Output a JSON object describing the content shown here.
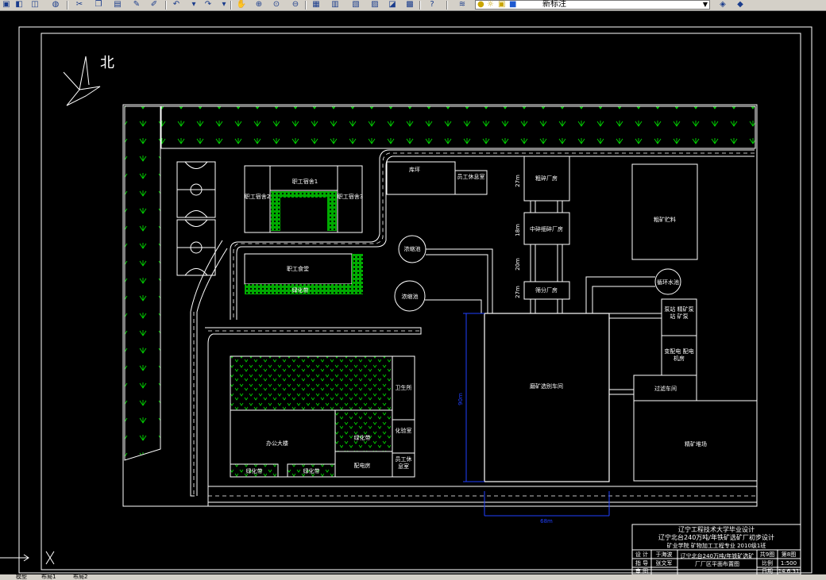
{
  "toolbar": {
    "layer_name": "新标注",
    "icons": [
      "open-icon",
      "save-icon",
      "print-icon",
      "cut-icon",
      "copy-icon",
      "paste-icon",
      "undo-icon",
      "redo-icon",
      "pan-icon",
      "zoom-icon",
      "zoom-window-icon",
      "zoom-previous-icon",
      "properties-icon",
      "design-center-icon",
      "tool-palette-icon",
      "calculator-icon",
      "help-icon",
      "layer-manager-icon",
      "layer-state-icon"
    ]
  },
  "drawing": {
    "north_label": "北",
    "buildings": {
      "dorm1": "职工宿舍1",
      "dorm2": "职工宿舍2",
      "dorm3": "职工宿舍3",
      "canteen": "职工食堂",
      "greenbelt": "绿化带",
      "warehouse": "库坪",
      "staff_rest_1": "员工休息室",
      "coarse_crusher": "粗碎厂房",
      "mid_fine_crusher": "中碎细碎厂房",
      "screening": "筛分厂房",
      "ore_bin": "粗矿贮料",
      "thickener_1": "浓缩池",
      "thickener_2": "浓缩池",
      "circulating_pool": "循环水池",
      "pump_house": "泵站 精矿泵站 矿泵",
      "substation": "变配电 配电机房",
      "main_plant": "磨矿选别车间",
      "filter_plant": "过滤车间",
      "concentrate_yard": "精矿堆场",
      "clinic": "卫生所",
      "lab": "化验室",
      "staff_rest_2": "员工休息室",
      "office": "办公大楼",
      "office_green": "绿化带",
      "green_1": "绿化带",
      "green_2": "绿化带",
      "power_room": "配电房"
    },
    "dims": {
      "d_coarse": "27m",
      "d_mid1": "18m",
      "d_mid2": "20m",
      "d_screen": "27m",
      "d_left": "90m",
      "d_bottom": "68m"
    },
    "title_block": {
      "school": "辽宁工程技术大学毕业设计",
      "project": "辽宁北台240万吨/年铁矿选矿厂初步设计",
      "major_line": "矿业学院  矿物加工工程专业  2010级1班",
      "r1": "设 计",
      "r1_name": "于海波",
      "r2": "指 导",
      "r2_name": "张文军",
      "r3": "审 图",
      "drawing_title": "辽宁北台240万吨/年铁矿选矿厂厂区平面布置图",
      "sheets": "共9图",
      "sheet_no": "第8图",
      "scale_label": "比例",
      "scale": "1:500",
      "date_label": "日期",
      "date": "14.6.31"
    }
  },
  "status": {
    "tab_model": "模型",
    "tab_layout1": "布局1",
    "tab_layout2": "布局2"
  }
}
